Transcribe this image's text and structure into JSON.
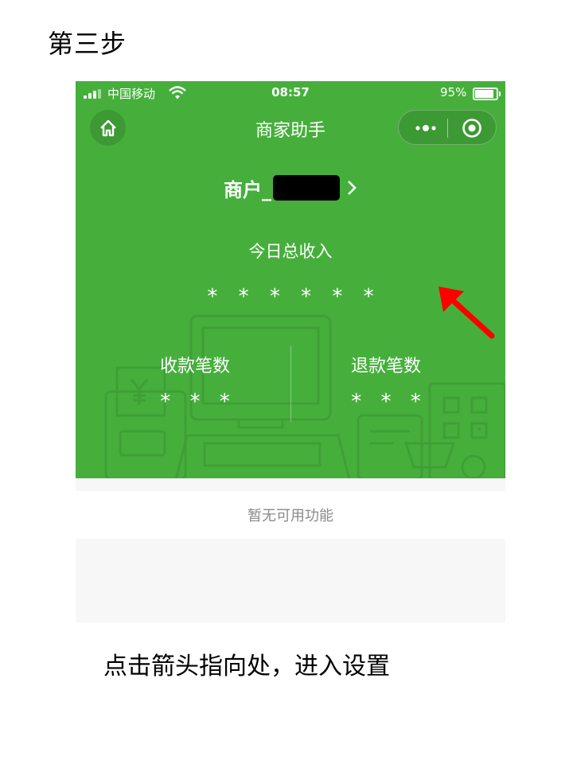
{
  "step_title": "第三步",
  "status_bar": {
    "carrier": "中国移动",
    "time": "08:57",
    "battery": "95%",
    "battery_level": 0.95,
    "wifi_icon": "wifi-icon",
    "signal_icon": "signal-icon"
  },
  "nav": {
    "home_icon": "home-icon",
    "title": "商家助手",
    "more_icon": "more-dots-icon",
    "close_icon": "target-icon"
  },
  "merchant": {
    "label": "商户_",
    "chevron": "›"
  },
  "income": {
    "label": "今日总收入",
    "value": "* * * * * *"
  },
  "stats": {
    "collections_label": "收款笔数",
    "collections_value": "* * *",
    "refunds_label": "退款笔数",
    "refunds_value": "* * *"
  },
  "functions": {
    "empty_text": "暂无可用功能"
  },
  "instruction": "点击箭头指向处，进入设置",
  "colors": {
    "brand_green": "#46af3c",
    "annotation_red": "#ff0000",
    "background_gray": "#f7f7f7"
  }
}
